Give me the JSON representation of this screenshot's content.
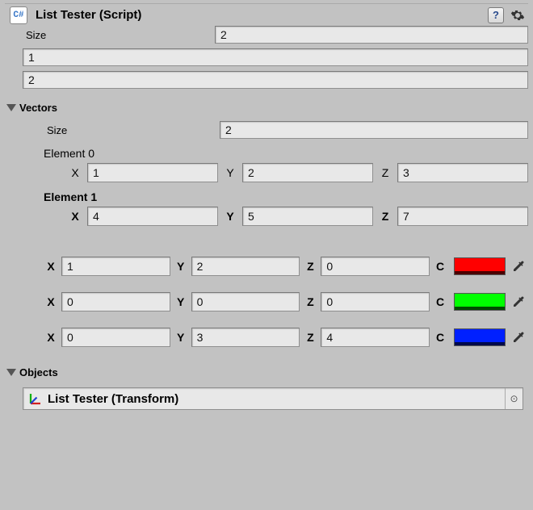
{
  "header": {
    "title": "List Tester (Script)",
    "badge": "C#"
  },
  "root": {
    "size_label": "Size",
    "size_value": "2",
    "items": [
      "1",
      "2"
    ]
  },
  "vectors": {
    "title": "Vectors",
    "size_label": "Size",
    "size_value": "2",
    "elements": [
      {
        "label": "Element 0",
        "x_label": "X",
        "x": "1",
        "y_label": "Y",
        "y": "2",
        "z_label": "Z",
        "z": "3"
      },
      {
        "label": "Element 1",
        "x_label": "X",
        "x": "4",
        "y_label": "Y",
        "y": "5",
        "z_label": "Z",
        "z": "7"
      }
    ],
    "color_rows": [
      {
        "x_label": "X",
        "x": "1",
        "y_label": "Y",
        "y": "2",
        "z_label": "Z",
        "z": "0",
        "c_label": "C",
        "color": "#ff0000"
      },
      {
        "x_label": "X",
        "x": "0",
        "y_label": "Y",
        "y": "0",
        "z_label": "Z",
        "z": "0",
        "c_label": "C",
        "color": "#00ff00"
      },
      {
        "x_label": "X",
        "x": "0",
        "y_label": "Y",
        "y": "3",
        "z_label": "Z",
        "z": "4",
        "c_label": "C",
        "color": "#0020ff"
      }
    ]
  },
  "objects": {
    "title": "Objects",
    "entry": "List Tester (Transform)"
  }
}
